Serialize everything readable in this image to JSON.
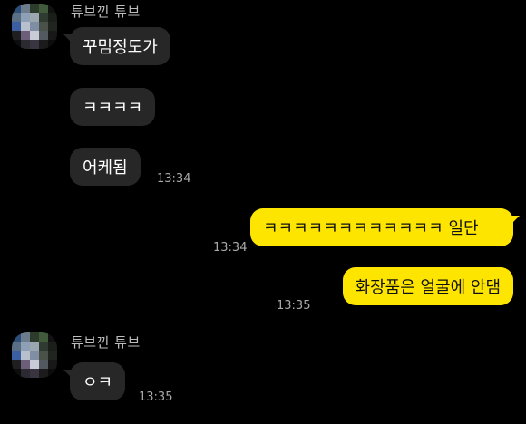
{
  "messages": [
    {
      "sender": "튜브낀 튜브",
      "text": "꾸밈정도가"
    },
    {
      "text": "ㅋㅋㅋㅋ"
    },
    {
      "text": "어케됨",
      "time": "13:34"
    },
    {
      "text": "ㅋㅋㅋㅋㅋㅋㅋㅋㅋㅋㅋㅋ 일단",
      "time": "13:34"
    },
    {
      "text": "화장품은 얼굴에 안댐",
      "time": "13:35"
    },
    {
      "sender": "튜브낀 튜브",
      "text": "ㅇㅋ",
      "time": "13:35"
    }
  ],
  "colors": {
    "background": "#000000",
    "incoming_bubble": "#272727",
    "outgoing_bubble": "#FEE500"
  }
}
